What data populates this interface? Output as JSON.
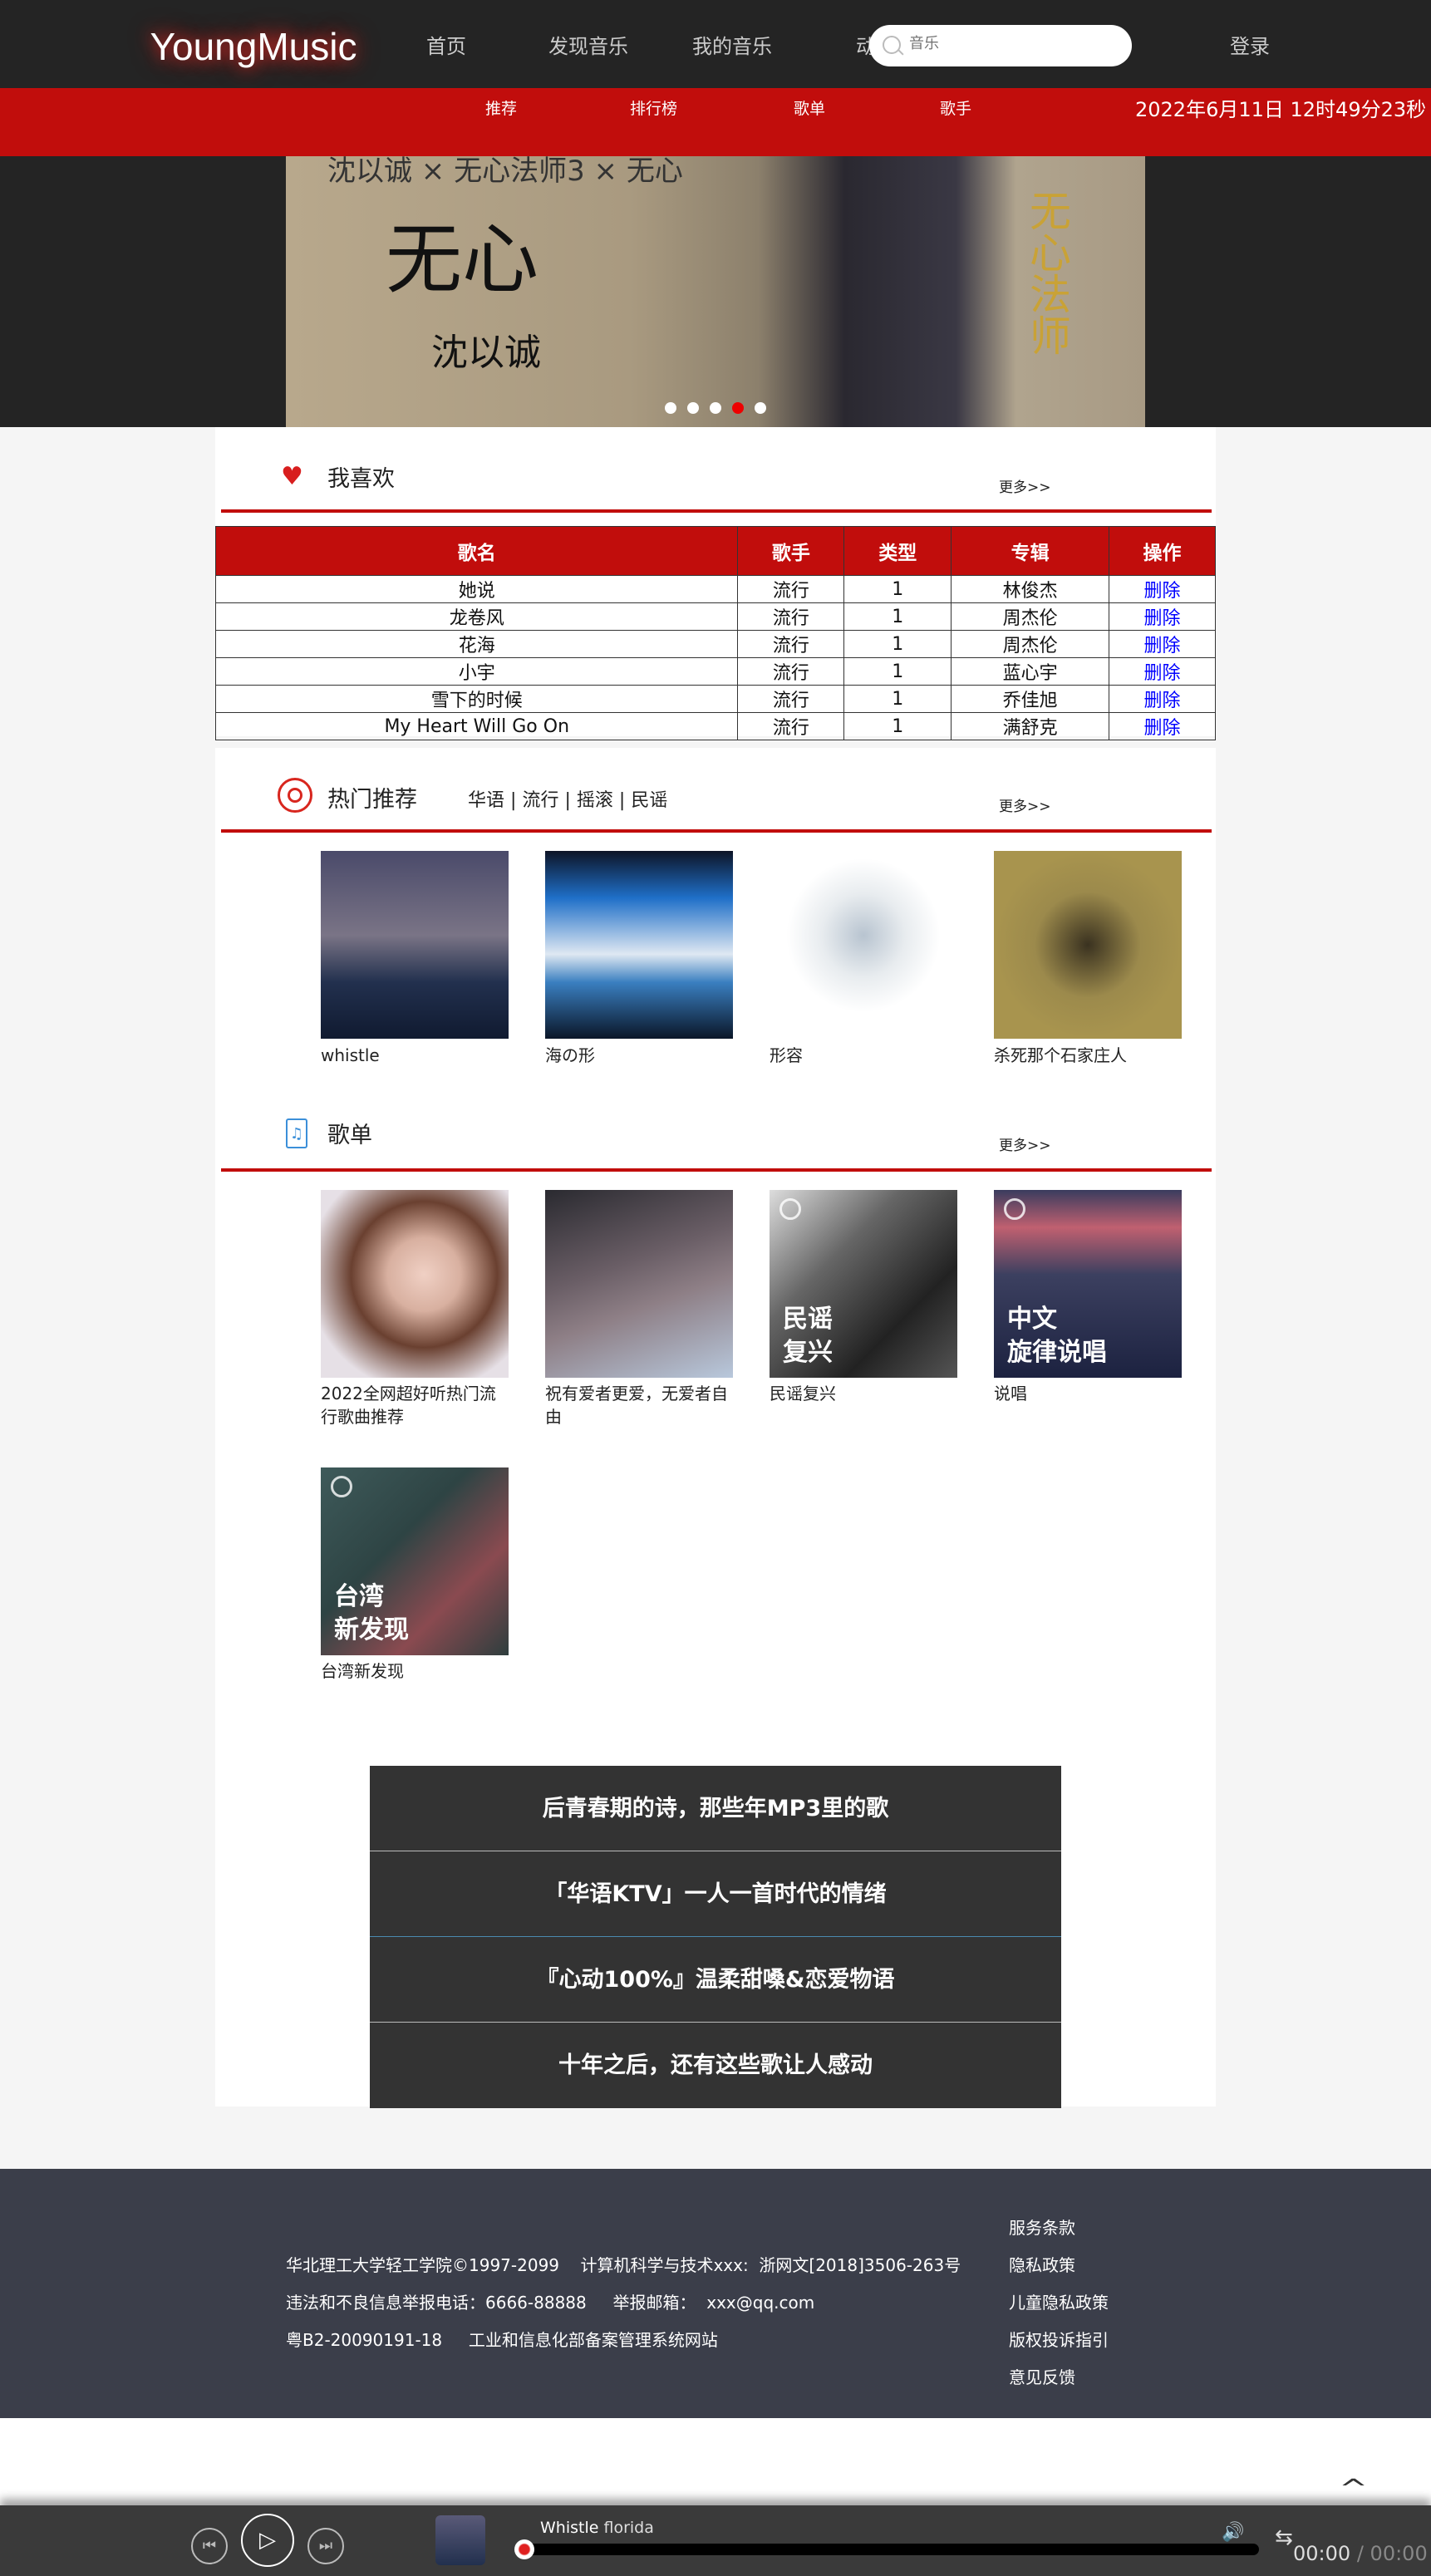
{
  "header": {
    "logo": "YoungMusic",
    "nav": [
      "首页",
      "发现音乐",
      "我的音乐",
      "动"
    ],
    "search_placeholder": "音乐",
    "login": "登录"
  },
  "subnav": {
    "items": [
      "推荐",
      "排行榜",
      "歌单",
      "歌手"
    ],
    "datetime": "2022年6月11日  12时49分23秒"
  },
  "banner": {
    "slide_count": 5,
    "active_slide": 4,
    "lettering": [
      "沈以诚 × 无心法师3 × 无心",
      "无心",
      "沈以诚",
      "无心法师"
    ]
  },
  "favorites": {
    "title": "我喜欢",
    "more": "更多>>",
    "columns": [
      "歌名",
      "歌手",
      "类型",
      "专辑",
      "操作"
    ],
    "rows": [
      {
        "name": "她说",
        "singer": "流行",
        "type": "1",
        "album": "林俊杰",
        "action": "删除"
      },
      {
        "name": "龙卷风",
        "singer": "流行",
        "type": "1",
        "album": "周杰伦",
        "action": "删除"
      },
      {
        "name": "花海",
        "singer": "流行",
        "type": "1",
        "album": "周杰伦",
        "action": "删除"
      },
      {
        "name": "小宇",
        "singer": "流行",
        "type": "1",
        "album": "蓝心宇",
        "action": "删除"
      },
      {
        "name": "雪下的时候",
        "singer": "流行",
        "type": "1",
        "album": "乔佳旭",
        "action": "删除"
      },
      {
        "name": "My Heart Will Go On",
        "singer": "流行",
        "type": "1",
        "album": "满舒克",
        "action": "删除"
      }
    ]
  },
  "hot": {
    "title": "热门推荐",
    "tags": [
      "华语",
      "流行",
      "摇滚",
      "民谣"
    ],
    "separator": "|",
    "more": "更多>>",
    "items": [
      {
        "label": "whistle"
      },
      {
        "label": "海の形"
      },
      {
        "label": "形容"
      },
      {
        "label": "杀死那个石家庄人"
      }
    ]
  },
  "playlists": {
    "title": "歌单",
    "more": "更多>>",
    "items": [
      {
        "label": "2022全网超好听热门流行歌曲推荐",
        "plate": ""
      },
      {
        "label": "祝有爱者更爱，无爱者自由",
        "plate": ""
      },
      {
        "label": "民谣复兴",
        "plate": "民谣\n复兴"
      },
      {
        "label": "说唱",
        "plate": "中文\n旋律说唱"
      },
      {
        "label": "台湾新发现",
        "plate": "台湾\n新发现"
      }
    ]
  },
  "featured": [
    "后青春期的诗，那些年MP3里的歌",
    "「华语KTV」一人一首时代的情绪",
    "『心动100%』温柔甜嗓&恋爱物语",
    "十年之后，还有这些歌让人感动"
  ],
  "footer": {
    "left": [
      "华北理工大学轻工学院©1997-2099    计算机科学与技术xxx:  浙网文[2018]3506-263号",
      "违法和不良信息举报电话：6666-88888     举报邮箱：  xxx@qq.com",
      "粤B2-20090191-18     工业和信息化部备案管理系统网站"
    ],
    "right": [
      "服务条款",
      "隐私政策",
      "儿童隐私政策",
      "版权投诉指引",
      "意见反馈"
    ]
  },
  "player": {
    "title": "Whistle",
    "artist": "florida",
    "current_time": "00:00",
    "total_time": "00:00",
    "progress": 0
  },
  "colors": {
    "brand": "#c10d0c",
    "topbar": "#242424",
    "footer": "#3b3e4a"
  }
}
